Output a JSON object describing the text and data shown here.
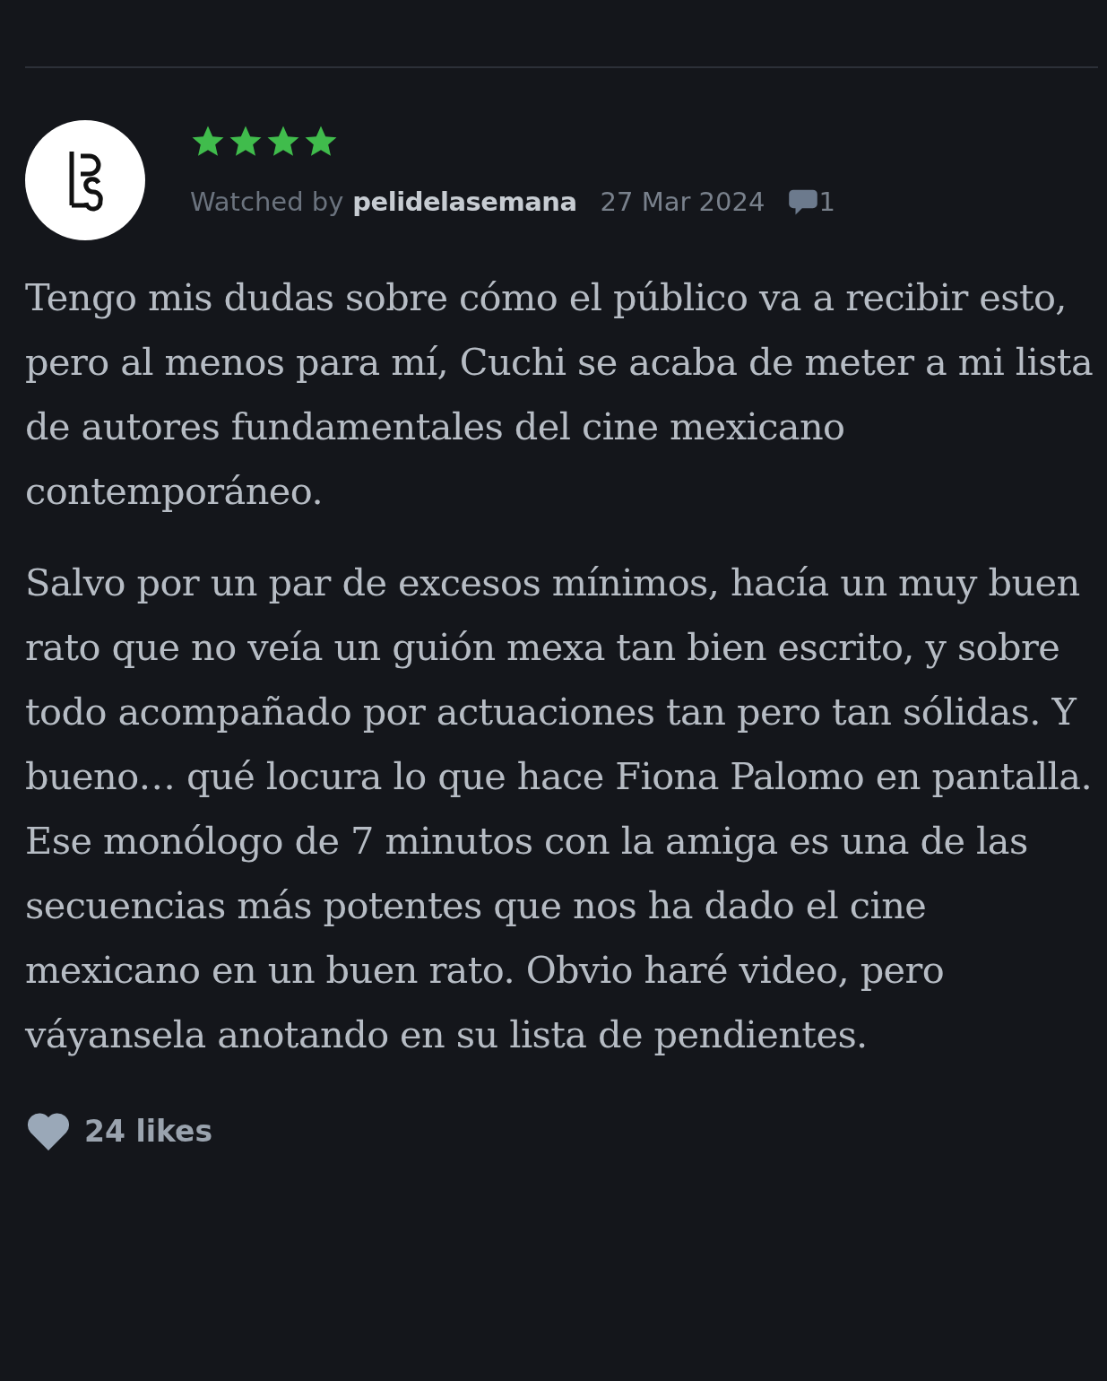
{
  "review": {
    "stars": 4,
    "watched_label": "Watched by",
    "username": "pelidelasemana",
    "date": "27 Mar 2024",
    "comment_count": "1",
    "paragraphs": [
      "Tengo mis dudas sobre cómo el público va a recibir esto, pero al menos para mí, Cuchi se acaba de meter a mi lista de autores fundamentales del cine mexicano contemporáneo.",
      "Salvo por un par de excesos mínimos, hacía un muy buen rato que no veía un guión mexa tan bien escrito, y sobre todo acompañado por actuaciones tan pero tan sólidas. Y bueno… qué locura lo que hace Fiona Palomo en pantalla. Ese monólogo de 7 minutos con la amiga es una de las secuencias más potentes que nos ha dado el cine mexicano en un buen rato. Obvio haré video, pero váyansela anotando en su lista de pendientes."
    ],
    "likes": "24 likes"
  }
}
